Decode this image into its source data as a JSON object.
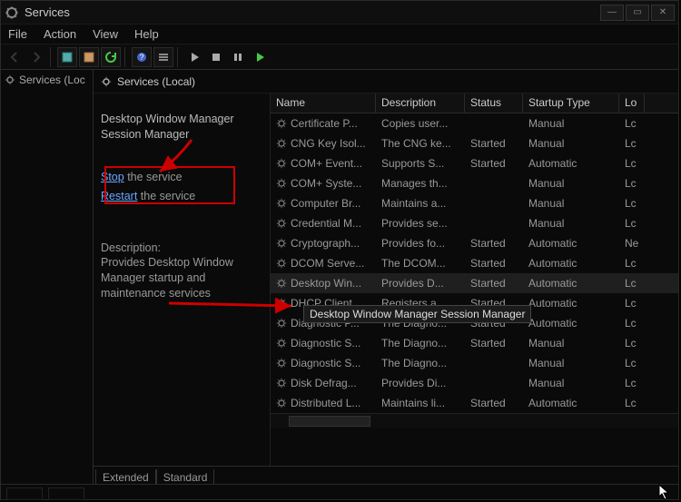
{
  "window": {
    "title": "Services"
  },
  "menu": {
    "file": "File",
    "action": "Action",
    "view": "View",
    "help": "Help"
  },
  "tree": {
    "root": "Services (Loc"
  },
  "pane": {
    "header": "Services (Local)"
  },
  "detail": {
    "title": "Desktop Window Manager Session Manager",
    "stop_link": "Stop",
    "stop_rest": " the service",
    "restart_link": "Restart",
    "restart_rest": " the service",
    "desc_label": "Description:",
    "desc_text": "Provides Desktop Window Manager startup and maintenance services"
  },
  "columns": {
    "name": "Name",
    "description": "Description",
    "status": "Status",
    "startup": "Startup Type",
    "logon": "Lo"
  },
  "tooltip": "Desktop Window Manager Session Manager",
  "rows": [
    {
      "name": "Certificate P...",
      "desc": "Copies user...",
      "status": "",
      "startup": "Manual",
      "logon": "Lc"
    },
    {
      "name": "CNG Key Isol...",
      "desc": "The CNG ke...",
      "status": "Started",
      "startup": "Manual",
      "logon": "Lc"
    },
    {
      "name": "COM+ Event...",
      "desc": "Supports S...",
      "status": "Started",
      "startup": "Automatic",
      "logon": "Lc"
    },
    {
      "name": "COM+ Syste...",
      "desc": "Manages th...",
      "status": "",
      "startup": "Manual",
      "logon": "Lc"
    },
    {
      "name": "Computer Br...",
      "desc": "Maintains a...",
      "status": "",
      "startup": "Manual",
      "logon": "Lc"
    },
    {
      "name": "Credential M...",
      "desc": "Provides se...",
      "status": "",
      "startup": "Manual",
      "logon": "Lc"
    },
    {
      "name": "Cryptograph...",
      "desc": "Provides fo...",
      "status": "Started",
      "startup": "Automatic",
      "logon": "Ne"
    },
    {
      "name": "DCOM Serve...",
      "desc": "The DCOM...",
      "status": "Started",
      "startup": "Automatic",
      "logon": "Lc"
    },
    {
      "name": "Desktop Win...",
      "desc": "Provides D...",
      "status": "Started",
      "startup": "Automatic",
      "logon": "Lc",
      "selected": true
    },
    {
      "name": "DHCP Client",
      "desc": "Registers a...",
      "status": "Started",
      "startup": "Automatic",
      "logon": "Lc"
    },
    {
      "name": "Diagnostic P...",
      "desc": "The Diagno...",
      "status": "Started",
      "startup": "Automatic",
      "logon": "Lc"
    },
    {
      "name": "Diagnostic S...",
      "desc": "The Diagno...",
      "status": "Started",
      "startup": "Manual",
      "logon": "Lc"
    },
    {
      "name": "Diagnostic S...",
      "desc": "The Diagno...",
      "status": "",
      "startup": "Manual",
      "logon": "Lc"
    },
    {
      "name": "Disk Defrag...",
      "desc": "Provides Di...",
      "status": "",
      "startup": "Manual",
      "logon": "Lc"
    },
    {
      "name": "Distributed L...",
      "desc": "Maintains li...",
      "status": "Started",
      "startup": "Automatic",
      "logon": "Lc"
    }
  ],
  "tabs": {
    "extended": "Extended",
    "standard": "Standard"
  }
}
